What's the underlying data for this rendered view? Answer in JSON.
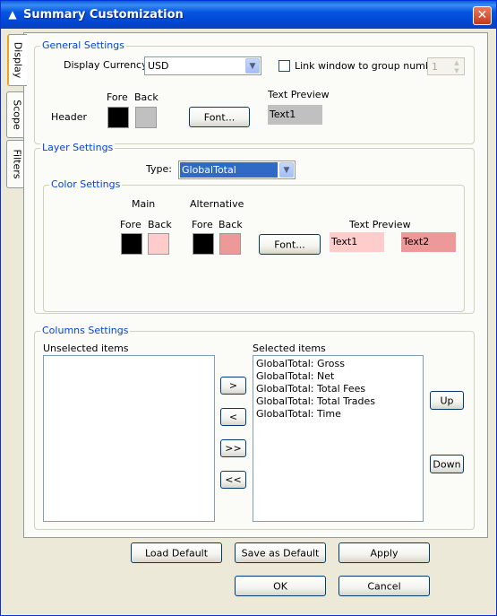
{
  "window": {
    "title": "Summary Customization",
    "close_symbol": "✕"
  },
  "tabs": [
    {
      "label": "Display"
    },
    {
      "label": "Scope"
    },
    {
      "label": "Filters"
    }
  ],
  "general": {
    "legend": "General Settings",
    "currency_label": "Display Currency:",
    "currency_value": "USD",
    "link_label": "Link window to group number:",
    "link_checked": false,
    "group_number": "1",
    "header_label": "Header",
    "fore_label": "Fore",
    "back_label": "Back",
    "fore_color": "#000000",
    "back_color": "#c0c0c0",
    "font_button": "Font...",
    "preview_label": "Text Preview",
    "preview_text": "Text1",
    "preview_bg": "#c0c0c0"
  },
  "layer": {
    "legend": "Layer Settings",
    "type_label": "Type:",
    "type_value": "GlobalTotal",
    "color_legend": "Color Settings",
    "main_label": "Main",
    "alt_label": "Alternative",
    "fore_label": "Fore",
    "back_label": "Back",
    "main_fore_color": "#000000",
    "main_back_color": "#ffcccc",
    "alt_fore_color": "#000000",
    "alt_back_color": "#ee9999",
    "font_button": "Font...",
    "preview_label": "Text Preview",
    "preview_text1": "Text1",
    "preview_text2": "Text2"
  },
  "columns": {
    "legend": "Columns Settings",
    "unselected_label": "Unselected items",
    "selected_label": "Selected items",
    "unselected_items": [],
    "selected_items": [
      "GlobalTotal: Gross",
      "GlobalTotal: Net",
      "GlobalTotal: Total Fees",
      "GlobalTotal: Total Trades",
      "GlobalTotal: Time"
    ],
    "add_button": ">",
    "remove_button": "<",
    "add_all_button": ">>",
    "remove_all_button": "<<",
    "up_button": "Up",
    "down_button": "Down"
  },
  "footer": {
    "load_default": "Load Default",
    "save_default": "Save as Default",
    "apply": "Apply",
    "ok": "OK",
    "cancel": "Cancel"
  }
}
